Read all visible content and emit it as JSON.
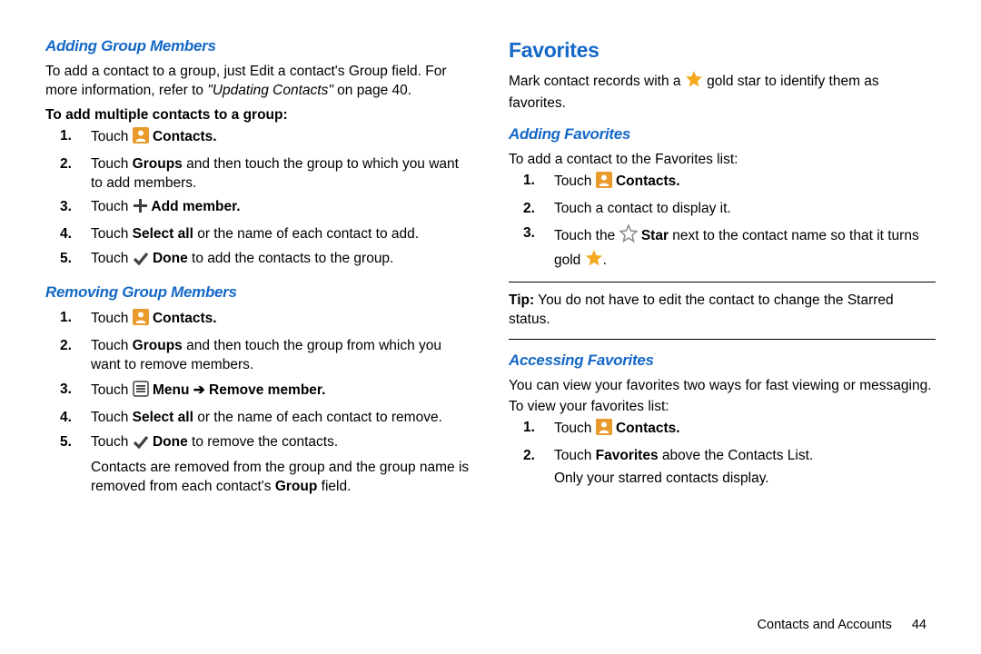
{
  "left": {
    "h_add_members": "Adding Group Members",
    "p1_a": "To add a contact to a group, just Edit a contact's Group field. For more information, refer to ",
    "p1_ital": "\"Updating Contacts\"",
    "p1_b": " on page 40.",
    "bl1": "To add multiple contacts to a group:",
    "s1_1a": "Touch ",
    "s1_1b": " Contacts.",
    "s1_2a": "Touch ",
    "s1_2b": "Groups",
    "s1_2c": " and then touch the group to which you want to add members.",
    "s1_3a": "Touch ",
    "s1_3b": " Add member.",
    "s1_4a": "Touch ",
    "s1_4b": "Select all",
    "s1_4c": " or the name of each contact to add.",
    "s1_5a": "Touch ",
    "s1_5b": " Done",
    "s1_5c": " to add the contacts to the group.",
    "h_rem_members": "Removing Group Members",
    "s2_1a": "Touch ",
    "s2_1b": " Contacts.",
    "s2_2a": "Touch ",
    "s2_2b": "Groups",
    "s2_2c": " and then touch the group from which you want to remove members.",
    "s2_3a": "Touch ",
    "s2_3b": " Menu ➔ Remove member.",
    "s2_4a": "Touch ",
    "s2_4b": "Select all",
    "s2_4c": " or the name of each contact to remove.",
    "s2_5a": "Touch ",
    "s2_5b": " Done",
    "s2_5c": " to remove the contacts.",
    "s2_tail_a": "Contacts are removed from the group and the group name is removed from each contact's ",
    "s2_tail_b": "Group",
    "s2_tail_c": " field."
  },
  "right": {
    "h_fav": "Favorites",
    "p1a": "Mark contact records with a ",
    "p1b": " gold star to identify them as favorites.",
    "h_add_fav": "Adding Favorites",
    "p2": "To add a contact to the Favorites list:",
    "s3_1a": "Touch ",
    "s3_1b": " Contacts.",
    "s3_2": "Touch a contact to display it.",
    "s3_3a": "Touch the ",
    "s3_3b": " Star",
    "s3_3c": " next to the contact name so that it turns gold ",
    "tip_label": "Tip:",
    "tip_text": " You do not have to edit the contact to change the Starred status.",
    "h_acc_fav": "Accessing Favorites",
    "p3": "You can view your favorites two ways for fast viewing or messaging.",
    "p4": "To view your favorites list:",
    "s4_1a": "Touch ",
    "s4_1b": " Contacts.",
    "s4_2a": "Touch ",
    "s4_2b": "Favorites",
    "s4_2c": " above the Contacts List.",
    "s4_tail": "Only your starred contacts display."
  },
  "footer": {
    "section": "Contacts and Accounts",
    "page": "44"
  }
}
